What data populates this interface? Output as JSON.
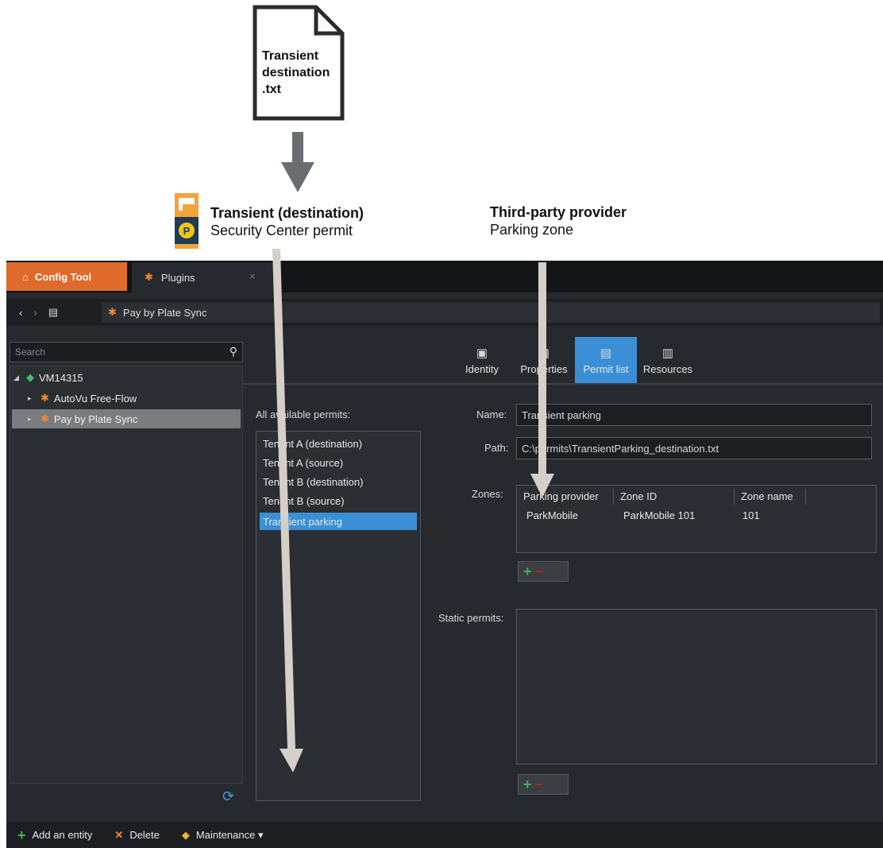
{
  "document": {
    "text": "Transient\ndestination\n.txt"
  },
  "annotations": {
    "left_line1": "Transient (destination)",
    "left_line2": "Security Center permit",
    "right_line1": "Third-party provider",
    "right_line2": "Parking zone"
  },
  "tabs": {
    "config": "Config Tool",
    "plugins": "Plugins"
  },
  "breadcrumb": "Pay by Plate Sync",
  "search": {
    "placeholder": "Search"
  },
  "tree": {
    "root": "VM14315",
    "items": [
      "AutoVu Free-Flow",
      "Pay by Plate Sync"
    ]
  },
  "bottom_bar": {
    "add": "Add an entity",
    "delete": "Delete",
    "maintenance": "Maintenance ▾"
  },
  "main_tabs": [
    "Identity",
    "Properties",
    "Permit list",
    "Resources"
  ],
  "permits": {
    "label": "All available permits:",
    "items": [
      "Tenant A (destination)",
      "Tenant A (source)",
      "Tenant B (destination)",
      "Tenant B (source)",
      "Transient parking"
    ],
    "selected": "Transient parking"
  },
  "form": {
    "name_label": "Name:",
    "name_value": "Transient parking",
    "path_label": "Path:",
    "path_value": "C:\\permits\\TransientParking_destination.txt",
    "zones_label": "Zones:",
    "static_label": "Static permits:"
  },
  "zones_table": {
    "headers": [
      "Parking provider",
      "Zone ID",
      "Zone name"
    ],
    "rows": [
      [
        "ParkMobile",
        "ParkMobile 101",
        "101"
      ]
    ]
  },
  "colors": {
    "accent": "#3a8fd6",
    "config_tab": "#e06a2b",
    "arrow": "#6a6e70",
    "callout": "#d4cfc9"
  }
}
